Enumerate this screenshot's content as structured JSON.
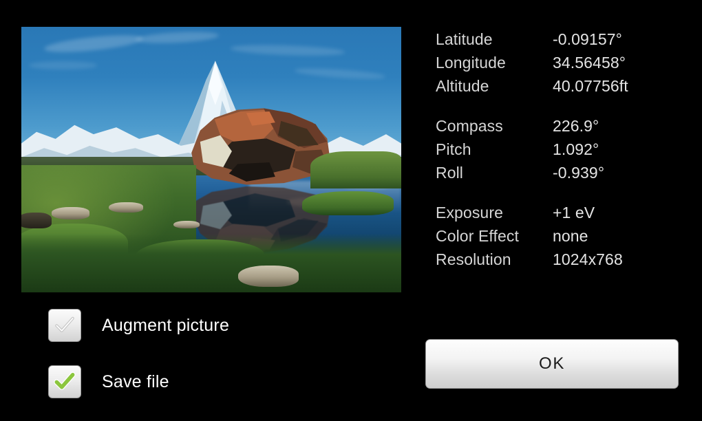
{
  "app": {
    "background_color": "#000000",
    "text_color": "#d6d6d6",
    "accent_green": "#8cc63e"
  },
  "photo": {
    "alt": "Matterhorn mountain reflected in Stellisee alpine lake with a large reddish boulder",
    "resolution_label": "1024x768"
  },
  "info": {
    "groups": [
      {
        "name": "location",
        "rows": [
          {
            "label": "Latitude",
            "value": "-0.09157°"
          },
          {
            "label": "Longitude",
            "value": "34.56458°"
          },
          {
            "label": "Altitude",
            "value": "40.07756ft"
          }
        ]
      },
      {
        "name": "orientation",
        "rows": [
          {
            "label": "Compass",
            "value": "226.9°"
          },
          {
            "label": "Pitch",
            "value": "1.092°"
          },
          {
            "label": "Roll",
            "value": "-0.939°"
          }
        ]
      },
      {
        "name": "camera",
        "rows": [
          {
            "label": "Exposure",
            "value": "+1 eV"
          },
          {
            "label": "Color Effect",
            "value": "none"
          },
          {
            "label": "Resolution",
            "value": "1024x768"
          }
        ]
      }
    ]
  },
  "checkboxes": [
    {
      "id": "augment-picture",
      "label": "Augment picture",
      "checked": false
    },
    {
      "id": "save-file",
      "label": "Save file",
      "checked": true
    }
  ],
  "buttons": {
    "ok_label": "OK"
  }
}
